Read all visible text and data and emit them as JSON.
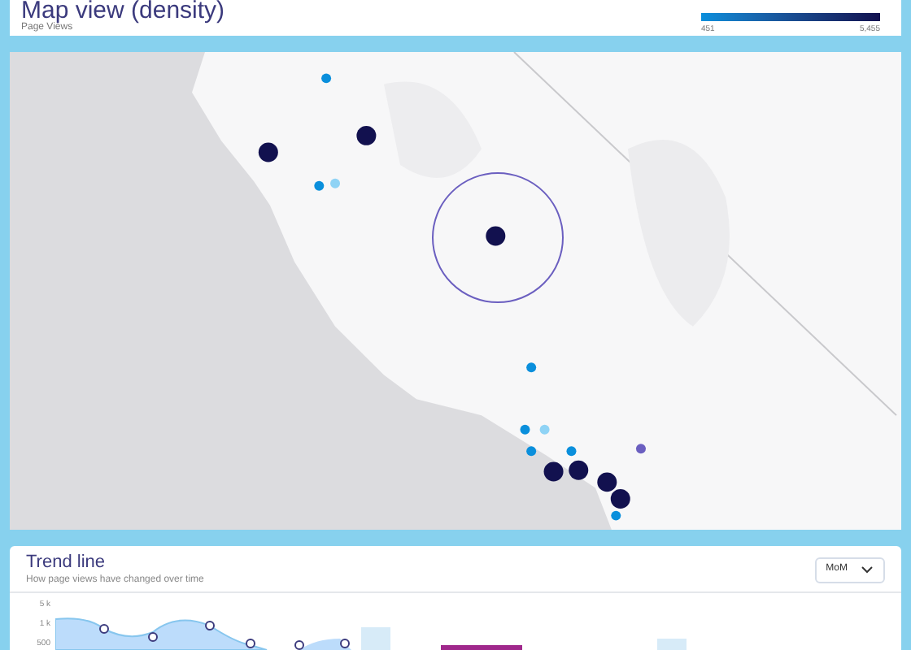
{
  "map_card": {
    "title": "Map view (density)",
    "subtitle": "Page Views",
    "legend": {
      "min": "451",
      "max": "5,455"
    }
  },
  "trend_card": {
    "title": "Trend line",
    "subtitle": "How page views have changed over time",
    "dropdown": "MoM",
    "y_labels": [
      "5 k",
      "1 k",
      "500"
    ]
  }
}
